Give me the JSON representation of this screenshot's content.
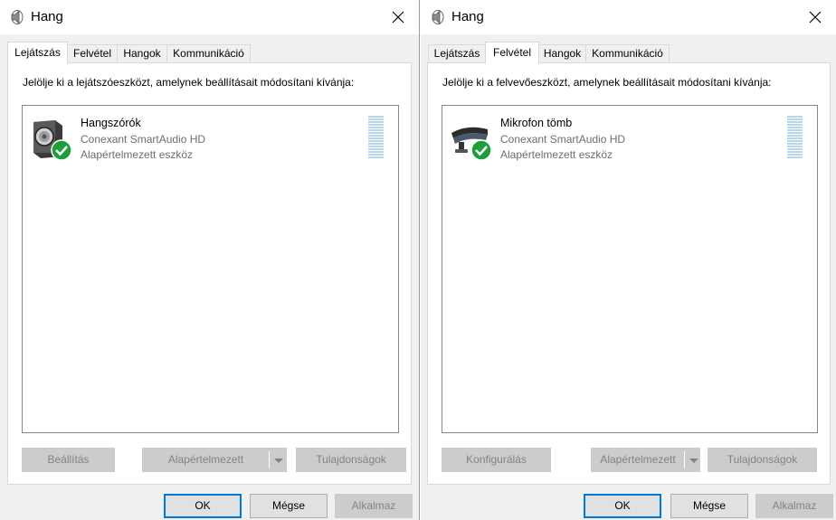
{
  "dialogs": {
    "left": {
      "title": "Hang",
      "tabs": [
        {
          "label": "Lejátszás",
          "active": true
        },
        {
          "label": "Felvétel",
          "active": false
        },
        {
          "label": "Hangok",
          "active": false
        },
        {
          "label": "Kommunikáció",
          "active": false
        }
      ],
      "instruction": "Jelölje ki a lejátszóeszközt, amelynek beállításait módosítani kívánja:",
      "device": {
        "name": "Hangszórók",
        "driver": "Conexant SmartAudio HD",
        "status": "Alapértelmezett eszköz",
        "icon": "speaker-icon",
        "level": 0
      },
      "buttons": {
        "configure": "Beállítás",
        "set_default": "Alapértelmezett",
        "properties": "Tulajdonságok"
      },
      "footer": {
        "ok": "OK",
        "cancel": "Mégse",
        "apply": "Alkalmaz"
      }
    },
    "right": {
      "title": "Hang",
      "tabs": [
        {
          "label": "Lejátszás",
          "active": false
        },
        {
          "label": "Felvétel",
          "active": true
        },
        {
          "label": "Hangok",
          "active": false
        },
        {
          "label": "Kommunikáció",
          "active": false
        }
      ],
      "instruction": "Jelölje ki a felvevőeszközt, amelynek beállításait módosítani kívánja:",
      "device": {
        "name": "Mikrofon tömb",
        "driver": "Conexant SmartAudio HD",
        "status": "Alapértelmezett eszköz",
        "icon": "microphone-array-icon",
        "level": 0
      },
      "buttons": {
        "configure": "Konfigurálás",
        "set_default": "Alapértelmezett",
        "properties": "Tulajdonságok"
      },
      "footer": {
        "ok": "OK",
        "cancel": "Mégse",
        "apply": "Alkalmaz"
      }
    }
  },
  "colors": {
    "dialog_bg": "#f0f0f0",
    "panel_bg": "#ffffff",
    "accent": "#0078d7",
    "level_meter": "#b6d8ea",
    "check_green": "#1e9e3a",
    "disabled_text": "#838383"
  }
}
